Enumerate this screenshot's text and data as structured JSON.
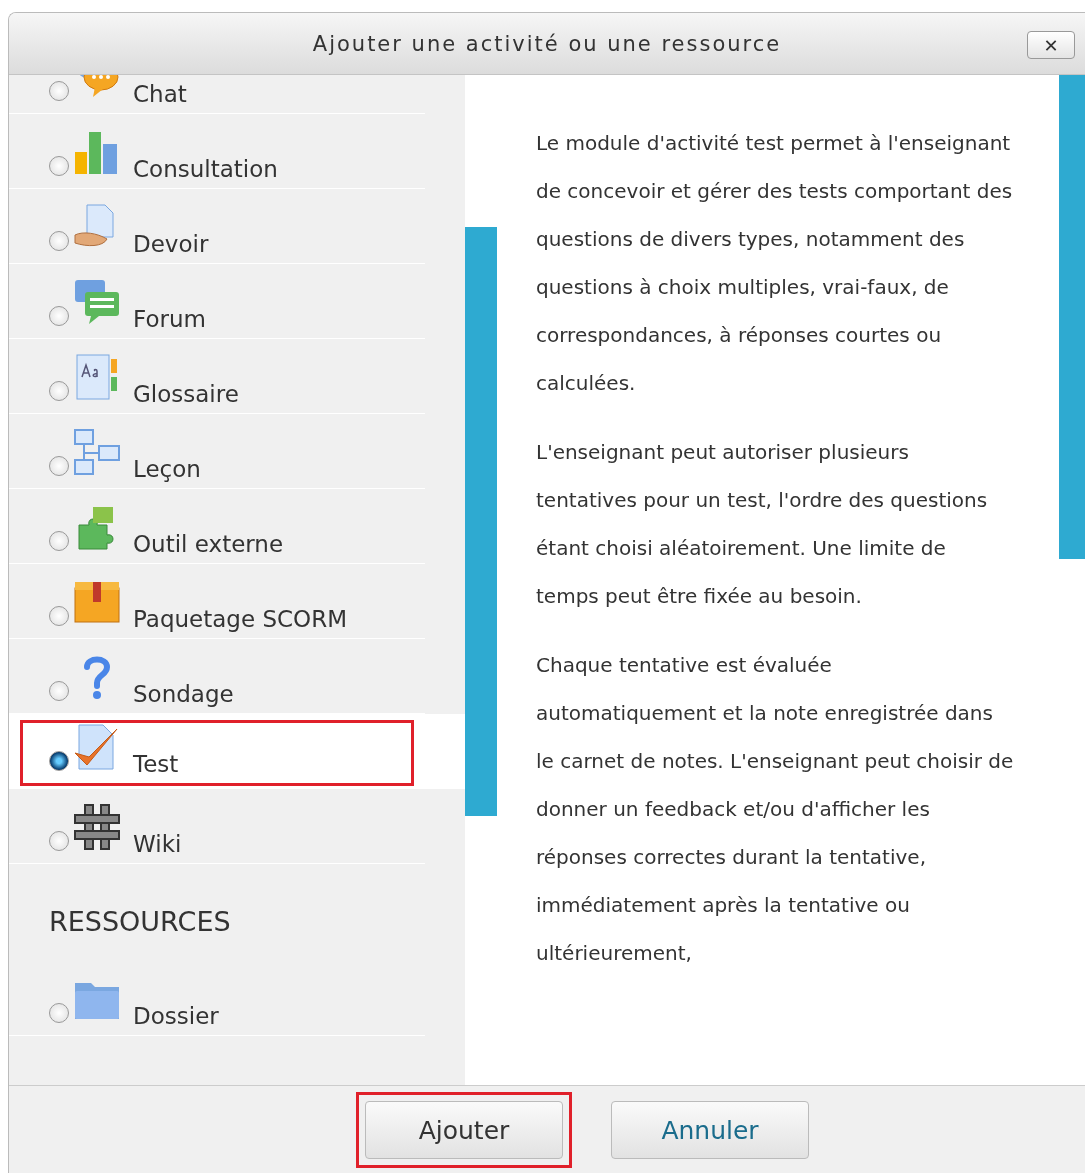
{
  "dialog": {
    "title": "Ajouter une activité ou une ressource",
    "close_label": "✕"
  },
  "activities": [
    {
      "label": "Chat",
      "selected": false
    },
    {
      "label": "Consultation",
      "selected": false
    },
    {
      "label": "Devoir",
      "selected": false
    },
    {
      "label": "Forum",
      "selected": false
    },
    {
      "label": "Glossaire",
      "selected": false
    },
    {
      "label": "Leçon",
      "selected": false
    },
    {
      "label": "Outil externe",
      "selected": false
    },
    {
      "label": "Paquetage SCORM",
      "selected": false
    },
    {
      "label": "Sondage",
      "selected": false
    },
    {
      "label": "Test",
      "selected": true
    },
    {
      "label": "Wiki",
      "selected": false
    }
  ],
  "resources_heading": "RESSOURCES",
  "resources": [
    {
      "label": "Dossier",
      "selected": false
    }
  ],
  "description": [
    "Le module d'activité test permet à l'enseignant de concevoir et gérer des tests comportant des questions de divers types, notamment des questions à choix multiples, vrai-faux, de correspondances, à réponses courtes ou calculées.",
    "L'enseignant peut autoriser plusieurs tentatives pour un test, l'ordre des questions étant choisi aléatoirement. Une limite de temps peut être fixée au besoin.",
    "Chaque tentative est évaluée automatiquement et la note enregistrée dans le carnet de notes. L'enseignant peut choisir de donner un feedback et/ou d'afficher les réponses correctes durant la tentative, immédiatement après la tentative ou ultérieurement,"
  ],
  "buttons": [
    {
      "label": "Ajouter",
      "highlighted": true
    },
    {
      "label": "Annuler",
      "highlighted": false
    }
  ]
}
